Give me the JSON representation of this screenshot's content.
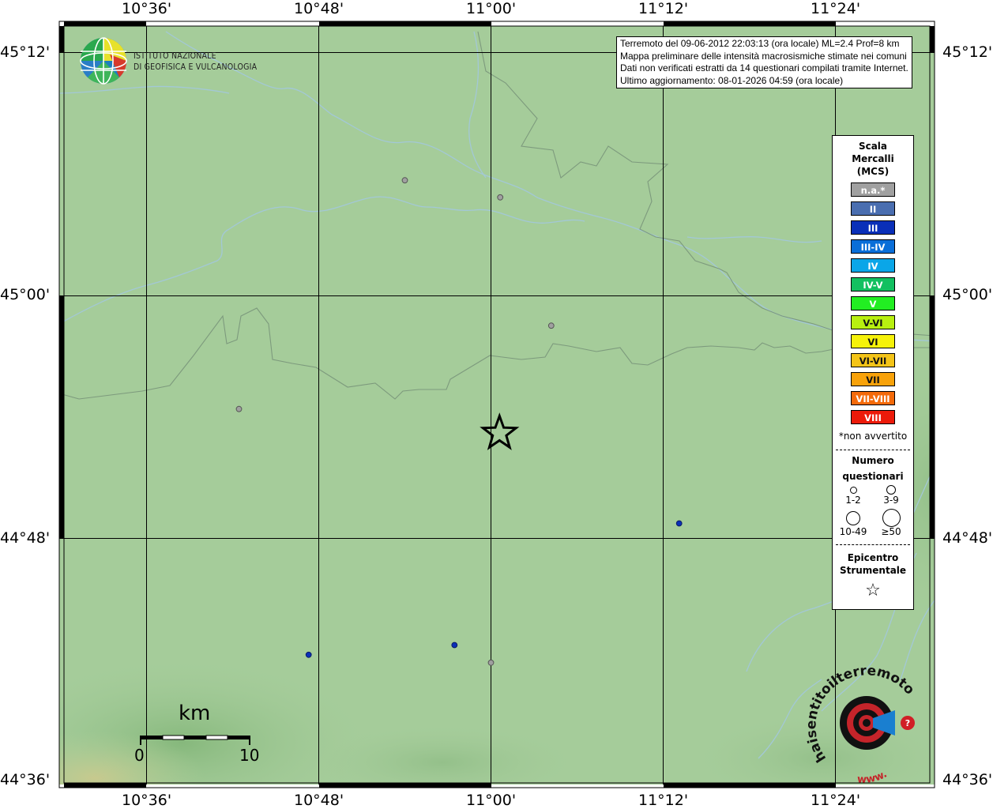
{
  "axes": {
    "top_lon_labels": [
      "10°36'",
      "10°48'",
      "11°00'",
      "11°12'",
      "11°24'"
    ],
    "bottom_lon_labels": [
      "10°36'",
      "10°48'",
      "11°00'",
      "11°12'",
      "11°24'"
    ],
    "left_lat_labels": [
      "45°12'",
      "45°00'",
      "44°48'",
      "44°36'"
    ],
    "right_lat_labels": [
      "45°12'",
      "45°00'",
      "44°48'",
      "44°36'"
    ]
  },
  "info": {
    "line1": "Terremoto del 09-06-2012 22:03:13 (ora locale) ML=2.4 Prof=8 km",
    "line2": "Mappa preliminare delle intensità macrosismiche stimate nei comuni",
    "line3": "Dati non verificati estratti da 14 questionari compilati tramite Internet.",
    "line4": "Ultimo aggiornamento: 08-01-2026 04:59 (ora locale)"
  },
  "ingv_logo": {
    "line1": "ISTITUTO NAZIONALE",
    "line2": "DI GEOFISICA E VULCANOLOGIA"
  },
  "legend": {
    "title_line1": "Scala",
    "title_line2": "Mercalli",
    "title_line3": "(MCS)",
    "classes": [
      {
        "label": "n.a.*",
        "color": "#a0a0a0"
      },
      {
        "label": "II",
        "color": "#4a6eb0"
      },
      {
        "label": "III",
        "color": "#0a2fb8"
      },
      {
        "label": "III-IV",
        "color": "#0a6ed8"
      },
      {
        "label": "IV",
        "color": "#0aa6e8"
      },
      {
        "label": "IV-V",
        "color": "#12c060"
      },
      {
        "label": "V",
        "color": "#22ee22"
      },
      {
        "label": "V-VI",
        "color": "#b8f010"
      },
      {
        "label": "VI",
        "color": "#f6f20a"
      },
      {
        "label": "VI-VII",
        "color": "#f4c418"
      },
      {
        "label": "VII",
        "color": "#f8a20a"
      },
      {
        "label": "VII-VIII",
        "color": "#f46a0a"
      },
      {
        "label": "VIII",
        "color": "#ec1a0a"
      }
    ],
    "note": "*non avvertito",
    "count_title1": "Numero",
    "count_title2": "questionari",
    "count_labels": [
      "1-2",
      "3-9",
      "10-49",
      "≥50"
    ],
    "epi_title1": "Epicentro",
    "epi_title2": "Strumentale",
    "star": "☆"
  },
  "scalebar": {
    "unit": "km",
    "start": "0",
    "end": "10"
  },
  "points": [
    {
      "lon": 10.9,
      "lat": 45.095,
      "intensity": "n.a.*",
      "color": "#a0a0a0"
    },
    {
      "lon": 11.0107,
      "lat": 45.081,
      "intensity": "n.a.*",
      "color": "#a0a0a0"
    },
    {
      "lon": 11.07,
      "lat": 44.9755,
      "intensity": "n.a.*",
      "color": "#a0a0a0"
    },
    {
      "lon": 10.7073,
      "lat": 44.907,
      "intensity": "n.a.*",
      "color": "#a0a0a0"
    },
    {
      "lon": 11.2185,
      "lat": 44.813,
      "intensity": "III",
      "color": "#0a2fb8"
    },
    {
      "lon": 10.7883,
      "lat": 44.705,
      "intensity": "III",
      "color": "#0a2fb8"
    },
    {
      "lon": 10.9576,
      "lat": 44.713,
      "intensity": "III",
      "color": "#0a2fb8"
    },
    {
      "lon": 11.0,
      "lat": 44.6985,
      "intensity": "n.a.*",
      "color": "#a0a0a0"
    }
  ],
  "epicenter": {
    "lon": 11.0099,
    "lat": 44.887
  },
  "hsit_logo": {
    "ring_text": "haisentitoilterremoto.it",
    "url_text": "www."
  }
}
